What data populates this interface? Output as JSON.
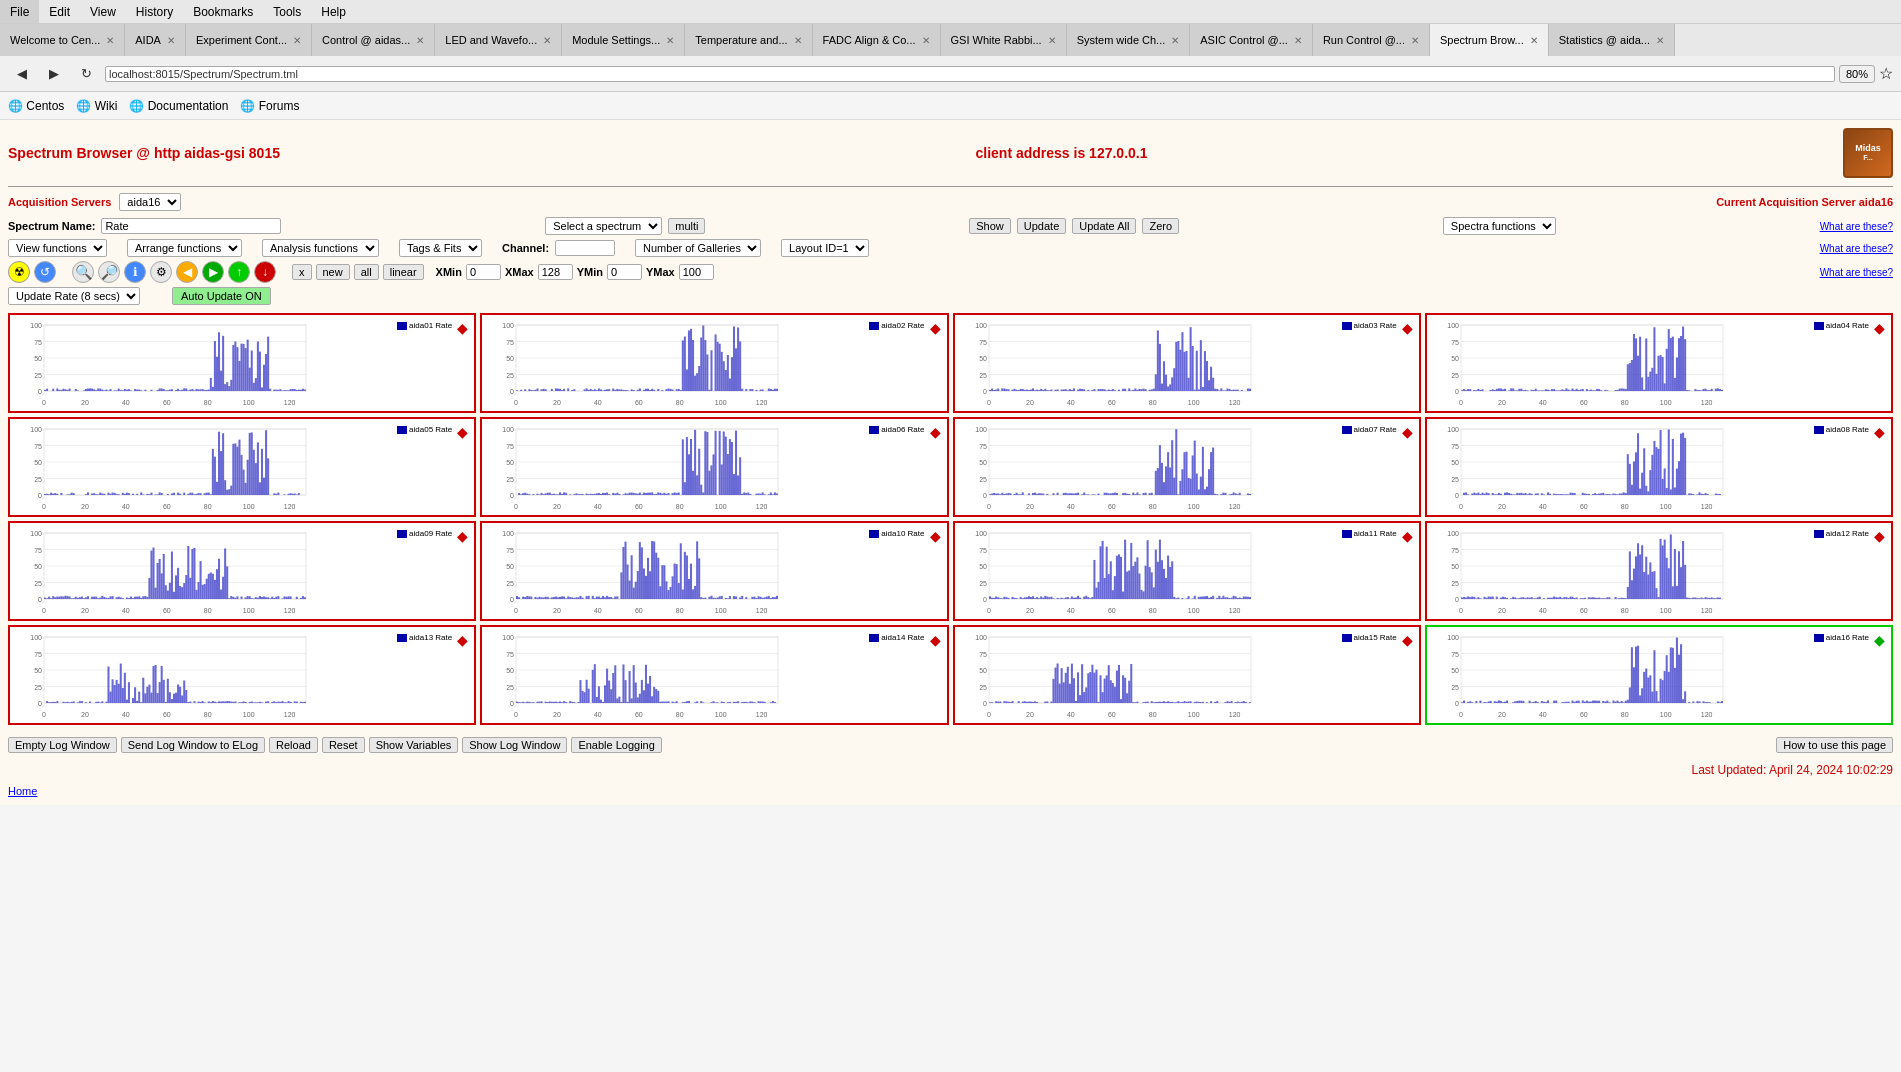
{
  "browser": {
    "tabs": [
      {
        "label": "Welcome to Cen...",
        "active": false
      },
      {
        "label": "AIDA",
        "active": false
      },
      {
        "label": "Experiment Cont...",
        "active": false
      },
      {
        "label": "Control @ aidas-...",
        "active": false
      },
      {
        "label": "LED and Wavefo...",
        "active": false
      },
      {
        "label": "Module Settings...",
        "active": false
      },
      {
        "label": "Temperature and...",
        "active": false
      },
      {
        "label": "FADC Align & Co...",
        "active": false
      },
      {
        "label": "GSI White Rabbi...",
        "active": false
      },
      {
        "label": "System wide Ch...",
        "active": false
      },
      {
        "label": "ASIC Control @...",
        "active": false
      },
      {
        "label": "Run Control @...",
        "active": false
      },
      {
        "label": "Spectrum Brow...",
        "active": true
      },
      {
        "label": "Statistics @ aida...",
        "active": false
      }
    ],
    "address": "localhost:8015/Spectrum/Spectrum.tml",
    "zoom": "80%",
    "menu": [
      "File",
      "Edit",
      "View",
      "History",
      "Bookmarks",
      "Tools",
      "Help"
    ],
    "bookmarks": [
      "Centos",
      "Wiki",
      "Documentation",
      "Forums"
    ]
  },
  "page": {
    "title": "Spectrum Browser @ http aidas-gsi 8015",
    "client_address": "client address is 127.0.0.1",
    "midas_logo": "Midas",
    "acquisition_servers_label": "Acquisition Servers",
    "acquisition_server_value": "aida16",
    "current_server_label": "Current Acquisition Server aida16",
    "spectrum_name_label": "Spectrum Name:",
    "spectrum_name_value": "Rate",
    "select_spectrum_label": "Select a spectrum",
    "multi_label": "multi",
    "show_label": "Show",
    "update_label": "Update",
    "update_all_label": "Update All",
    "zero_label": "Zero",
    "spectra_functions_label": "Spectra functions",
    "what_are_these_label": "What are these?",
    "view_functions_label": "View functions",
    "arrange_functions_label": "Arrange functions",
    "analysis_functions_label": "Analysis functions",
    "tags_fits_label": "Tags & Fits",
    "channel_label": "Channel:",
    "channel_value": "",
    "number_of_galleries_label": "Number of Galleries",
    "layout_id_label": "Layout ID=1",
    "x_label": "x",
    "new_label": "new",
    "all_label": "all",
    "linear_label": "linear",
    "xmin_label": "XMin",
    "xmin_value": "0",
    "xmax_label": "XMax",
    "xmax_value": "128",
    "ymin_label": "YMin",
    "ymin_value": "0",
    "ymax_label": "YMax",
    "ymax_value": "100",
    "update_rate_label": "Update Rate (8 secs)",
    "auto_update_label": "Auto Update ON",
    "galleries": [
      {
        "id": "aida01",
        "label": "aida01 Rate",
        "diamond": "red"
      },
      {
        "id": "aida02",
        "label": "aida02 Rate",
        "diamond": "red"
      },
      {
        "id": "aida03",
        "label": "aida03 Rate",
        "diamond": "red"
      },
      {
        "id": "aida04",
        "label": "aida04 Rate",
        "diamond": "red"
      },
      {
        "id": "aida05",
        "label": "aida05 Rate",
        "diamond": "red"
      },
      {
        "id": "aida06",
        "label": "aida06 Rate",
        "diamond": "red"
      },
      {
        "id": "aida07",
        "label": "aida07 Rate",
        "diamond": "red"
      },
      {
        "id": "aida08",
        "label": "aida08 Rate",
        "diamond": "red"
      },
      {
        "id": "aida09",
        "label": "aida09 Rate",
        "diamond": "red"
      },
      {
        "id": "aida10",
        "label": "aida10 Rate",
        "diamond": "red"
      },
      {
        "id": "aida11",
        "label": "aida11 Rate",
        "diamond": "red"
      },
      {
        "id": "aida12",
        "label": "aida12 Rate",
        "diamond": "red"
      },
      {
        "id": "aida13",
        "label": "aida13 Rate",
        "diamond": "red"
      },
      {
        "id": "aida14",
        "label": "aida14 Rate",
        "diamond": "red"
      },
      {
        "id": "aida15",
        "label": "aida15 Rate",
        "diamond": "red"
      },
      {
        "id": "aida16",
        "label": "aida16 Rate",
        "diamond": "green"
      }
    ],
    "bottom_buttons": {
      "empty_log": "Empty Log Window",
      "send_log": "Send Log Window to ELog",
      "reload": "Reload",
      "reset": "Reset",
      "show_variables": "Show Variables",
      "show_log": "Show Log Window",
      "enable_logging": "Enable Logging",
      "how_to": "How to use this page"
    },
    "last_updated": "Last Updated: April 24, 2024 10:02:29",
    "home_link": "Home"
  }
}
